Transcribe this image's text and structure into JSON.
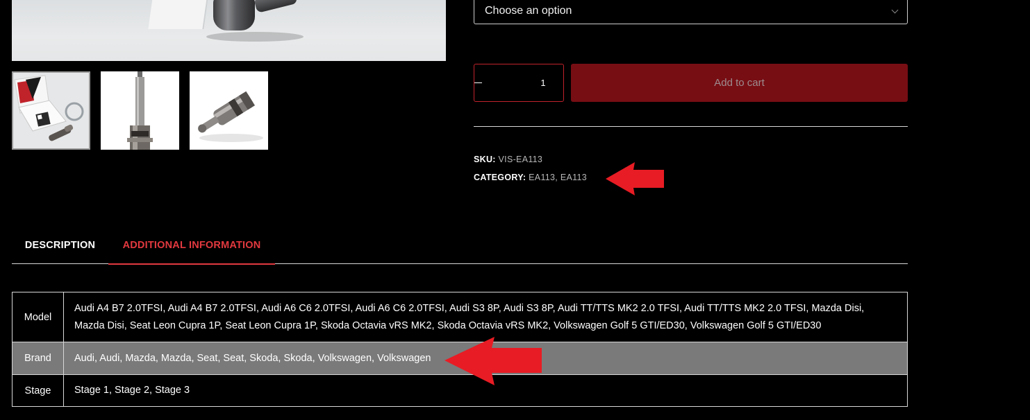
{
  "gallery": {
    "main_image_alt": "Product photo",
    "thumbnails": [
      "Thumbnail 1",
      "Thumbnail 2",
      "Thumbnail 3"
    ]
  },
  "variation": {
    "selected": "Choose an option"
  },
  "cart": {
    "quantity": "1",
    "add_to_cart_label": "Add to cart"
  },
  "meta": {
    "sku_label": "SKU:",
    "sku_value": "VIS-EA113",
    "category_label": "CATEGORY:",
    "categories": [
      "EA113",
      "EA113"
    ],
    "separator": ","
  },
  "tabs": [
    {
      "label": "DESCRIPTION",
      "active": false
    },
    {
      "label": "ADDITIONAL INFORMATION",
      "active": true
    }
  ],
  "attributes": [
    {
      "name": "Model",
      "value": "Audi A4 B7 2.0TFSI, Audi A4 B7 2.0TFSI, Audi A6 C6 2.0TFSI, Audi A6 C6 2.0TFSI, Audi S3 8P, Audi S3 8P, Audi TT/TTS MK2 2.0 TFSI, Audi TT/TTS MK2 2.0 TFSI, Mazda Disi, Mazda Disi, Seat Leon Cupra 1P, Seat Leon Cupra 1P, Skoda Octavia vRS MK2, Skoda Octavia vRS MK2, Volkswagen Golf 5 GTI/ED30, Volkswagen Golf 5 GTI/ED30"
    },
    {
      "name": "Brand",
      "value": "Audi, Audi, Mazda, Mazda, Seat, Seat, Skoda, Skoda, Volkswagen, Volkswagen"
    },
    {
      "name": "Stage",
      "value": "Stage 1, Stage 2, Stage 3"
    }
  ],
  "colors": {
    "accent_red": "#e2393f",
    "add_to_cart_bg": "#770e14",
    "annotation_arrow": "#e81c24",
    "highlight_row": "#7a7a7a"
  },
  "annotations": [
    "red-arrow",
    "red-arrow"
  ]
}
